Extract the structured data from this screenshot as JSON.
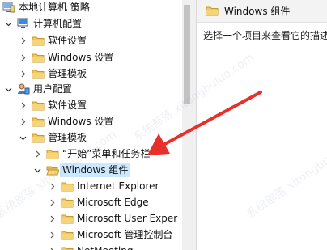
{
  "tree": {
    "items": [
      {
        "label": "本地计算机 策略",
        "icon": "policy-computer-icon",
        "expander": "expanded"
      },
      {
        "label": "计算机配置",
        "icon": "computer-config-icon",
        "expander": "expanded"
      },
      {
        "label": "软件设置",
        "icon": "folder-icon",
        "expander": "collapsed"
      },
      {
        "label": "Windows 设置",
        "icon": "folder-icon",
        "expander": "collapsed"
      },
      {
        "label": "管理模板",
        "icon": "folder-icon",
        "expander": "collapsed"
      },
      {
        "label": "用户配置",
        "icon": "user-config-icon",
        "expander": "expanded"
      },
      {
        "label": "软件设置",
        "icon": "folder-icon",
        "expander": "collapsed"
      },
      {
        "label": "Windows 设置",
        "icon": "folder-icon",
        "expander": "collapsed"
      },
      {
        "label": "管理模板",
        "icon": "folder-icon",
        "expander": "expanded"
      },
      {
        "label": "“开始”菜单和任务栏",
        "icon": "folder-icon",
        "expander": "collapsed"
      },
      {
        "label": "Windows 组件",
        "icon": "folder-open-icon",
        "expander": "expanded",
        "selected": true
      },
      {
        "label": "Internet Explorer",
        "icon": "folder-icon",
        "expander": "collapsed"
      },
      {
        "label": "Microsoft Edge",
        "icon": "folder-icon",
        "expander": "collapsed"
      },
      {
        "label": "Microsoft User Exper",
        "icon": "folder-icon",
        "expander": "collapsed"
      },
      {
        "label": "Microsoft 管理控制台",
        "icon": "folder-icon",
        "expander": "collapsed"
      },
      {
        "label": "NetMeeting",
        "icon": "folder-icon",
        "expander": "collapsed"
      }
    ]
  },
  "detail": {
    "title": "Windows 组件",
    "description": "选择一个项目来查看它的描述"
  },
  "watermark": "系统部落 xitongbuluo.com",
  "colors": {
    "selection": "#cce8ff",
    "folder": "#e8b84a",
    "arrow": "#e8302a"
  }
}
